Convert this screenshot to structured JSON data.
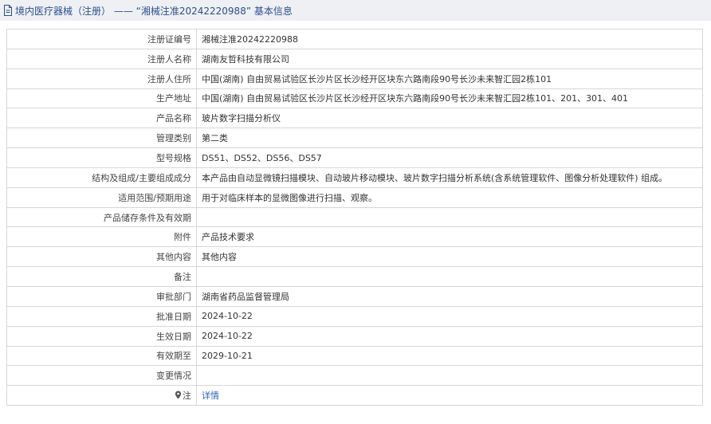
{
  "header": {
    "title": "境内医疗器械（注册） ——  “湘械注准20242220988”  基本信息"
  },
  "rows": [
    {
      "label": "注册证编号",
      "value": "湘械注准20242220988"
    },
    {
      "label": "注册人名称",
      "value": "湖南友哲科技有限公司"
    },
    {
      "label": "注册人住所",
      "value": "中国(湖南) 自由贸易试验区长沙片区长沙经开区块东六路南段90号长沙未来智汇园2栋101"
    },
    {
      "label": "生产地址",
      "value": "中国(湖南) 自由贸易试验区长沙片区长沙经开区块东六路南段90号长沙未来智汇园2栋101、201、301、401"
    },
    {
      "label": "产品名称",
      "value": "玻片数字扫描分析仪"
    },
    {
      "label": "管理类别",
      "value": "第二类"
    },
    {
      "label": "型号规格",
      "value": "DS51、DS52、DS56、DS57"
    },
    {
      "label": "结构及组成/主要组成成分",
      "value": "本产品由自动显微镜扫描模块、自动玻片移动模块、玻片数字扫描分析系统(含系统管理软件、图像分析处理软件) 组成。"
    },
    {
      "label": "适用范围/预期用途",
      "value": "用于对临床样本的显微图像进行扫描、观察。"
    },
    {
      "label": "产品储存条件及有效期",
      "value": ""
    },
    {
      "label": "附件",
      "value": "产品技术要求"
    },
    {
      "label": "其他内容",
      "value": "其他内容"
    },
    {
      "label": "备注",
      "value": ""
    },
    {
      "label": "审批部门",
      "value": "湖南省药品监督管理局"
    },
    {
      "label": "批准日期",
      "value": "2024-10-22"
    },
    {
      "label": "生效日期",
      "value": "2024-10-22"
    },
    {
      "label": "有效期至",
      "value": "2029-10-21"
    },
    {
      "label": "变更情况",
      "value": ""
    }
  ],
  "note": {
    "icon": "pin-icon",
    "label": "注",
    "link": "详情"
  }
}
